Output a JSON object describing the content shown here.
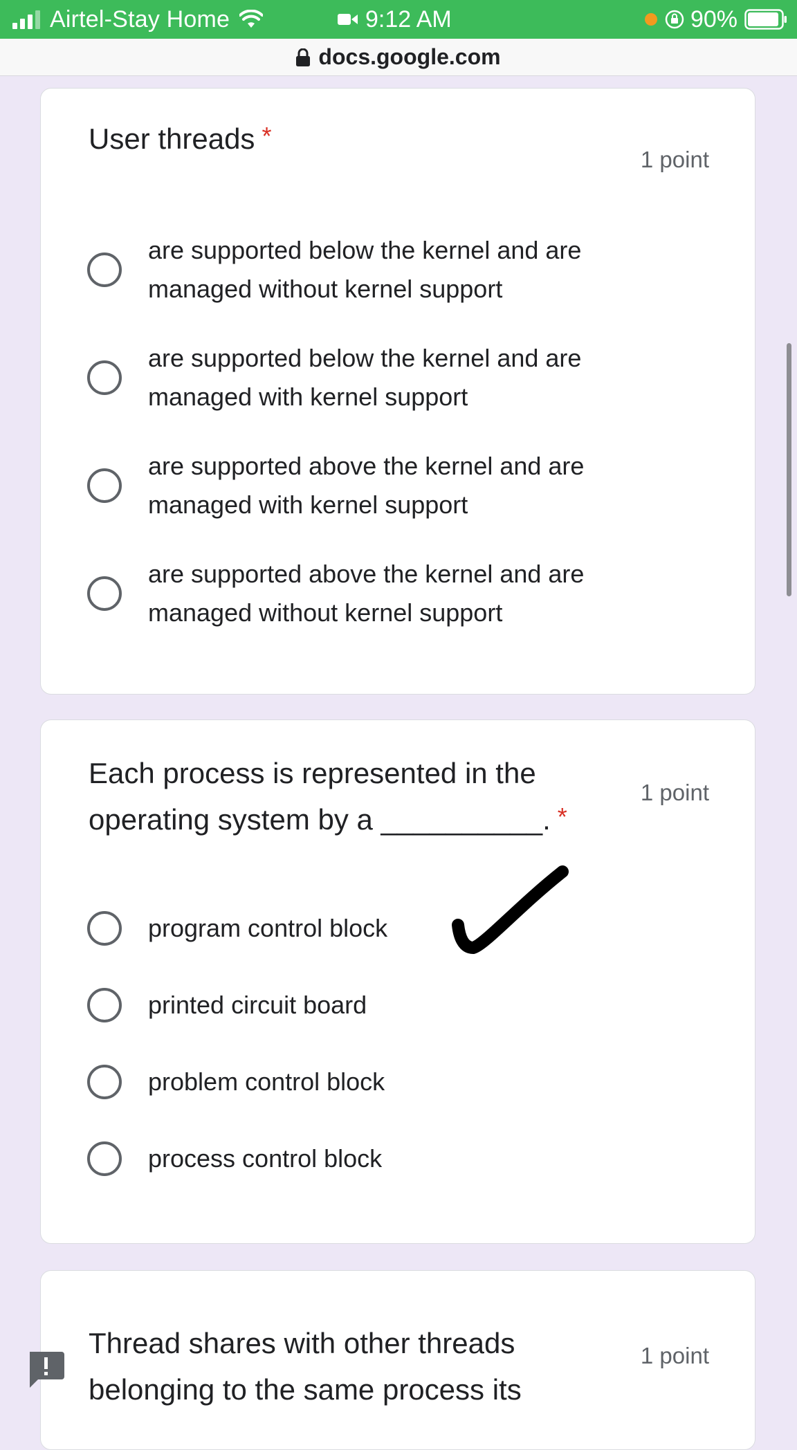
{
  "status_bar": {
    "carrier": "Airtel-Stay Home",
    "time": "9:12 AM",
    "battery": "90%"
  },
  "url_bar": {
    "url": "docs.google.com"
  },
  "questions": [
    {
      "title": "User threads",
      "required_mark": "*",
      "points": "1 point",
      "options": [
        "are supported below the kernel and are managed without kernel support",
        "are supported below the kernel and are managed with kernel support",
        "are supported above the kernel and are managed with kernel support",
        "are supported above the kernel and are managed without kernel support"
      ]
    },
    {
      "title": "Each process is represented in the operating system by a __________.",
      "required_mark": "*",
      "points": "1 point",
      "options": [
        "program control block",
        "printed circuit board",
        "problem control block",
        "process control block"
      ]
    },
    {
      "title": "Thread shares with other threads belonging to the same process its",
      "points": "1 point"
    }
  ],
  "colors": {
    "status_bar": "#3dbb5a",
    "page_background": "#ede7f6",
    "required": "#d93025",
    "handwritten_mark": "#000000"
  },
  "icons": {
    "signal": "cellular-signal-icon",
    "wifi": "wifi-icon",
    "camera": "video-camera-icon",
    "lock": "lock-icon",
    "orientation": "orientation-lock-icon",
    "battery": "battery-icon",
    "feedback": "feedback-icon",
    "checkmark": "handwritten-checkmark-icon"
  }
}
